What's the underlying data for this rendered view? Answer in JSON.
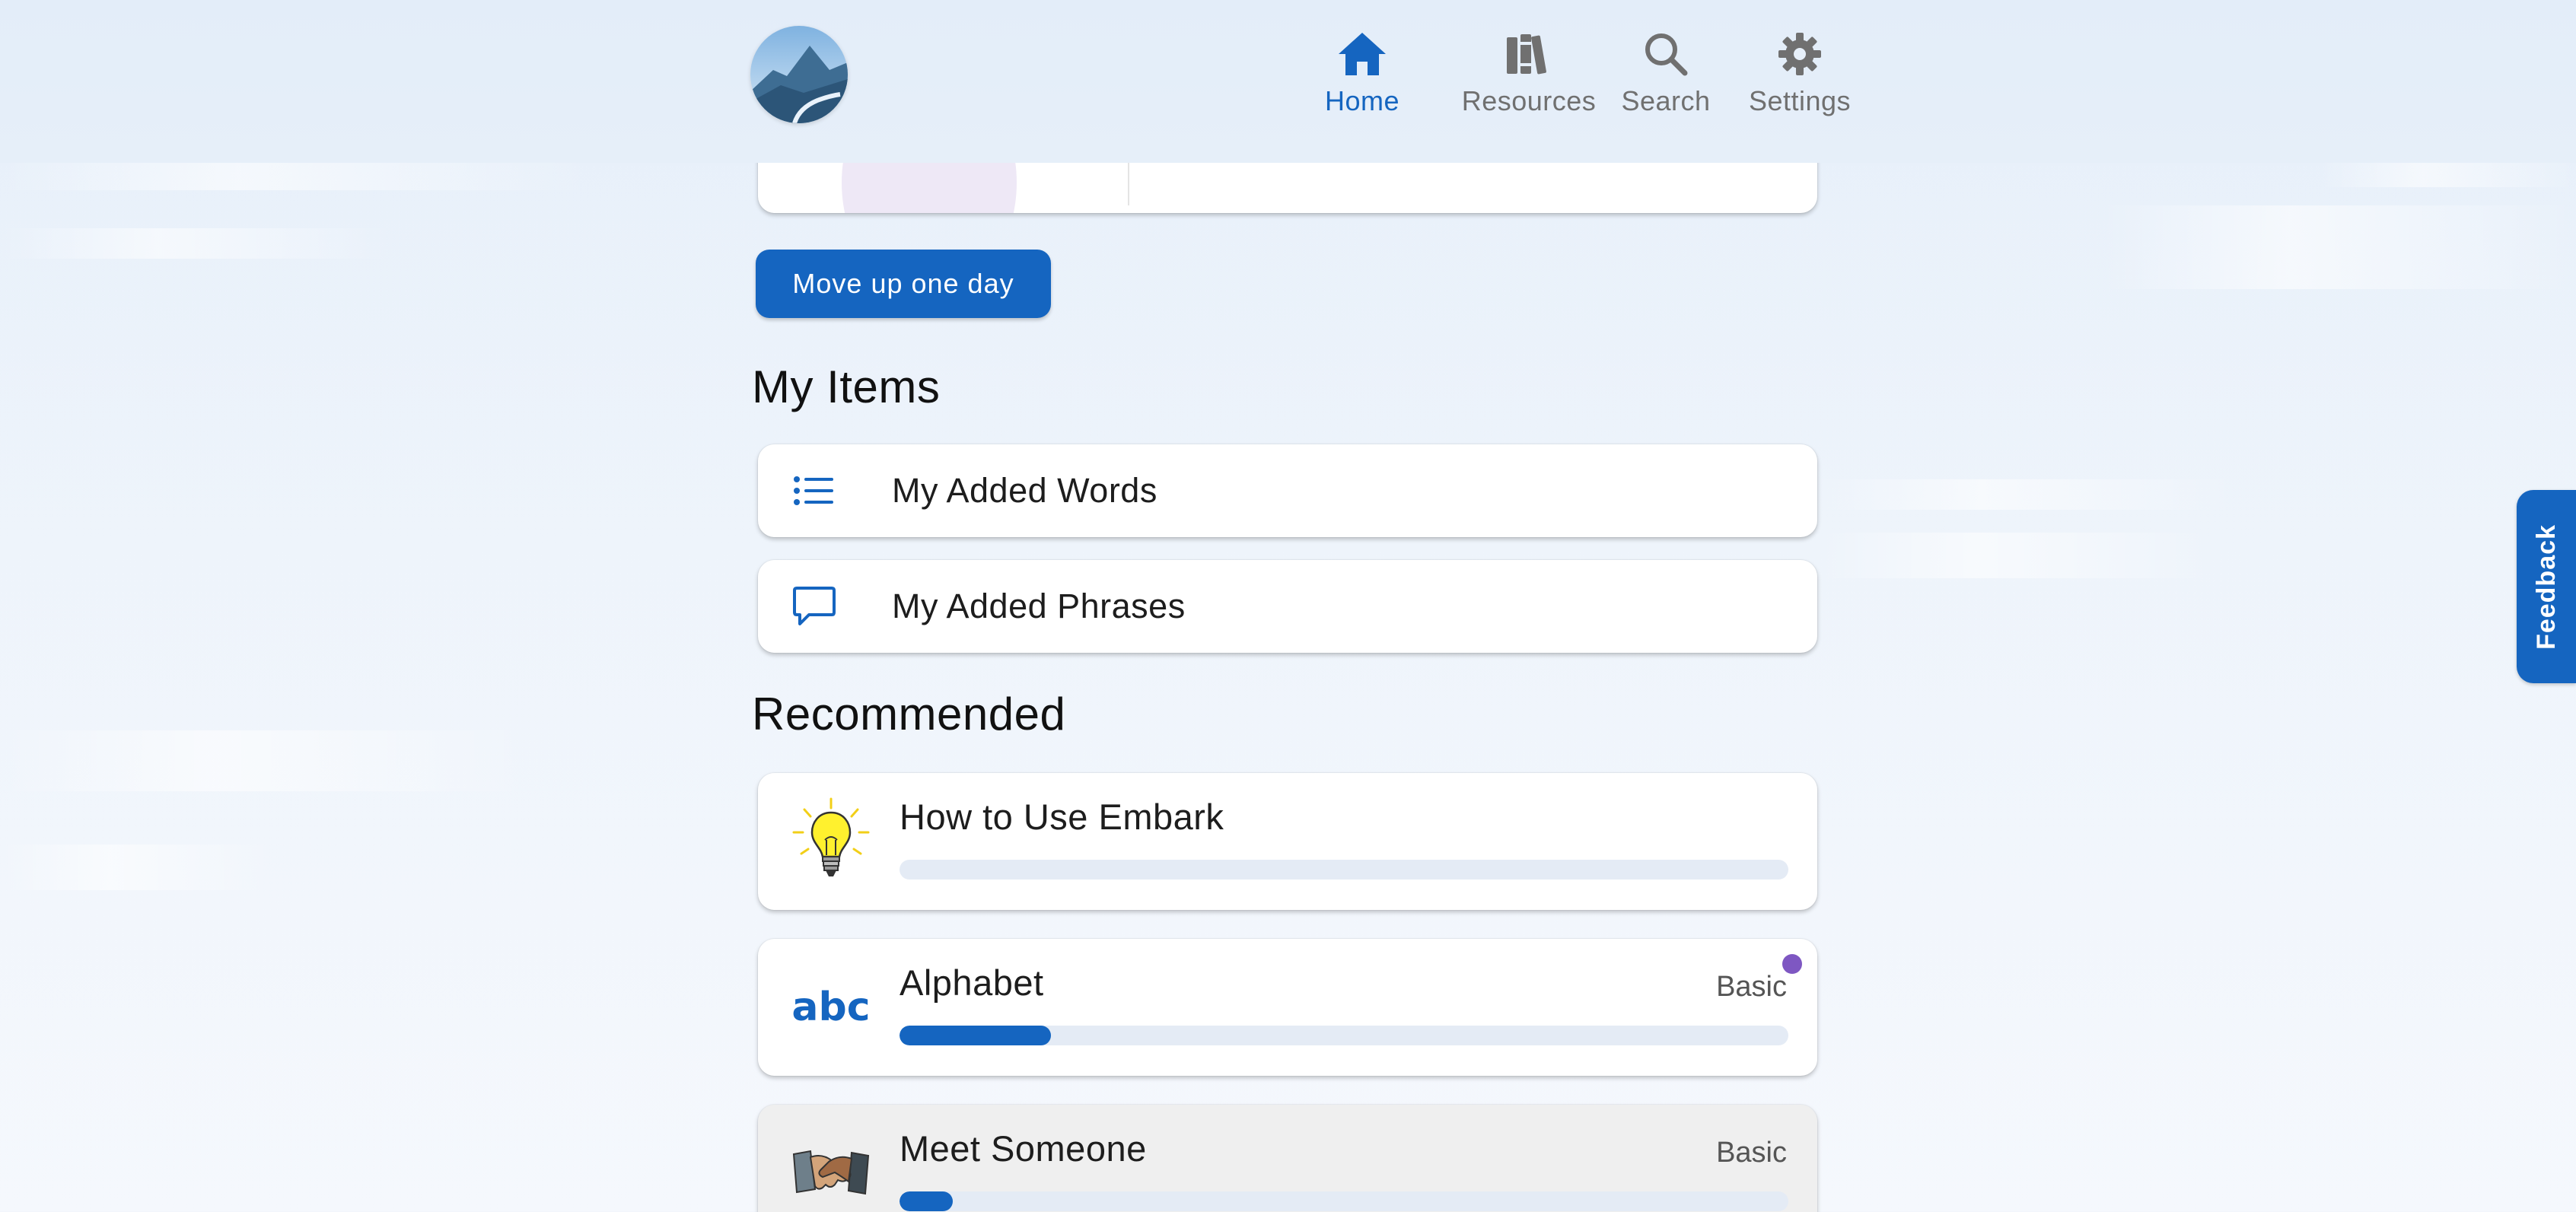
{
  "nav": {
    "items": [
      {
        "label": "Home",
        "icon": "home-icon",
        "active": true
      },
      {
        "label": "Resources",
        "icon": "books-icon",
        "active": false
      },
      {
        "label": "Search",
        "icon": "search-icon",
        "active": false
      },
      {
        "label": "Settings",
        "icon": "gear-icon",
        "active": false
      }
    ]
  },
  "actions": {
    "move_up_label": "Move up one day"
  },
  "my_items": {
    "title": "My Items",
    "items": [
      {
        "label": "My Added Words",
        "icon": "list-icon"
      },
      {
        "label": "My Added Phrases",
        "icon": "speech-bubble-icon"
      }
    ]
  },
  "recommended": {
    "title": "Recommended",
    "items": [
      {
        "title": "How to Use Embark",
        "icon": "lightbulb-icon",
        "level": "",
        "progress": 0.0
      },
      {
        "title": "Alphabet",
        "icon": "abc-icon",
        "icon_text": "abc",
        "level": "Basic",
        "progress": 0.17,
        "new_indicator": true
      },
      {
        "title": "Meet Someone",
        "icon": "handshake-icon",
        "level": "Basic",
        "progress": 0.06
      }
    ]
  },
  "feedback": {
    "label": "Feedback"
  },
  "colors": {
    "primary": "#1565c0",
    "accent_purple": "#7e57c2",
    "inactive_nav": "#707070",
    "track": "#e4ebf5"
  }
}
